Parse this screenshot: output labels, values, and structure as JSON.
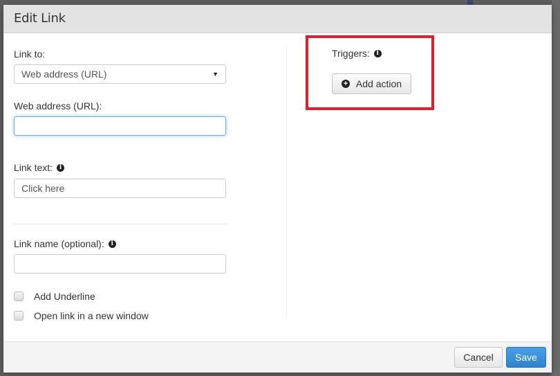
{
  "dialog": {
    "title": "Edit Link"
  },
  "left": {
    "link_to": {
      "label": "Link to:",
      "selected": "Web address (URL)"
    },
    "web_address": {
      "label": "Web address (URL):",
      "value": "",
      "placeholder": ""
    },
    "link_text": {
      "label": "Link text:",
      "value": "Click here"
    },
    "link_name": {
      "label": "Link name (optional):",
      "value": ""
    },
    "checkboxes": [
      {
        "label": "Add Underline",
        "checked": false
      },
      {
        "label": "Open link in a new window",
        "checked": false
      }
    ]
  },
  "right": {
    "triggers_label": "Triggers:",
    "add_action_label": "Add action",
    "highlight_color": "#e31d2b"
  },
  "icons": {
    "info": "i",
    "plus": "+",
    "caret": "▼"
  },
  "footer": {
    "cancel_label": "Cancel",
    "save_label": "Save",
    "primary_color": "#3a8fda"
  }
}
